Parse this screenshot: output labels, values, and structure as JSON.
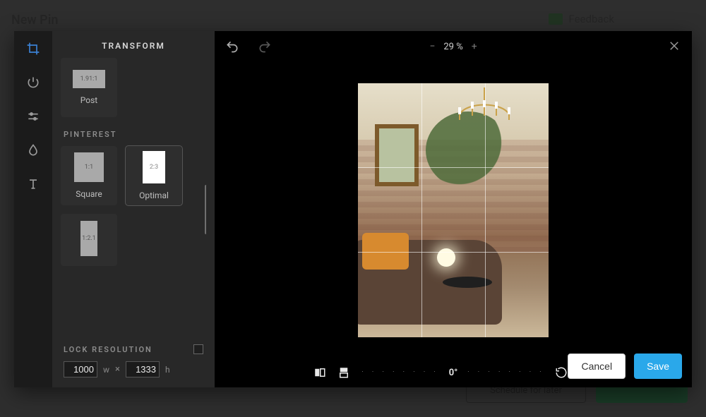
{
  "backdrop": {
    "title": "New Pin",
    "feedback": "Feedback",
    "schedule_label": "Schedule for later"
  },
  "panel": {
    "title": "TRANSFORM",
    "groups": {
      "post": {
        "ratio_text": "1.91:1",
        "label": "Post"
      },
      "pinterest": {
        "heading": "PINTEREST",
        "square": {
          "ratio_text": "1:1",
          "label": "Square"
        },
        "optimal": {
          "ratio_text": "2:3",
          "label": "Optimal"
        },
        "long": {
          "ratio_text": "1:2.1",
          "label": ""
        }
      }
    },
    "lock_label": "LOCK RESOLUTION",
    "width_value": "1000",
    "width_unit": "w",
    "times": "×",
    "height_value": "1333",
    "height_unit": "h"
  },
  "topbar": {
    "zoom_percent": "29 %",
    "zoom_minus": "−",
    "zoom_plus": "+"
  },
  "bottombar": {
    "degrees": "0°"
  },
  "footer": {
    "cancel": "Cancel",
    "save": "Save"
  },
  "icons": {
    "crop": "crop-icon",
    "power": "power-icon",
    "sliders": "sliders-icon",
    "drop": "drop-icon",
    "text": "text-icon",
    "undo": "undo-icon",
    "redo": "redo-icon",
    "close": "close-icon",
    "flip_h": "flip-horizontal-icon",
    "flip_v": "flip-vertical-icon",
    "rotate_ccw": "rotate-ccw-icon",
    "rotate_cw": "rotate-cw-icon"
  }
}
